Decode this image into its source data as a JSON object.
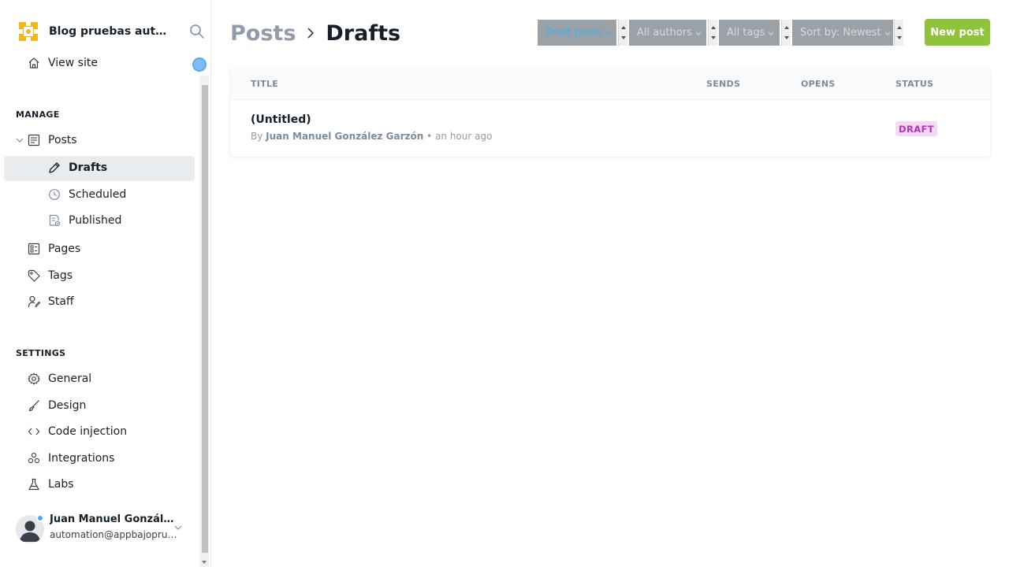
{
  "sidebar": {
    "site_title": "Blog pruebas automatizadas",
    "view_site": "View site",
    "manage_title": "MANAGE",
    "settings_title": "SETTINGS",
    "manage_items": {
      "posts": "Posts",
      "drafts": "Drafts",
      "scheduled": "Scheduled",
      "published": "Published",
      "pages": "Pages",
      "tags": "Tags",
      "staff": "Staff"
    },
    "settings_items": {
      "general": "General",
      "design": "Design",
      "code_injection": "Code injection",
      "integrations": "Integrations",
      "labs": "Labs"
    },
    "user": {
      "name": "Juan Manuel González Garzón",
      "email": "automation@appbajopruebas.com"
    }
  },
  "header": {
    "breadcrumb_parent": "Posts",
    "breadcrumb_current": "Drafts",
    "filters": {
      "type": "Draft posts",
      "author": "All authors",
      "tag": "All tags",
      "sort": "Sort by: Newest"
    },
    "new_post_label": "New post"
  },
  "table": {
    "columns": {
      "title": "TITLE",
      "sends": "SENDS",
      "opens": "OPENS",
      "status": "STATUS"
    },
    "rows": [
      {
        "title": "(Untitled)",
        "by": "By",
        "author": "Juan Manuel González Garzón",
        "time": "• an hour ago",
        "status": "DRAFT"
      }
    ]
  },
  "colors": {
    "accent": "#3eb0ef",
    "new_post": "#8fc33b",
    "draft_badge_bg": "#f5d8f3",
    "draft_badge_text": "#b82fbb"
  }
}
